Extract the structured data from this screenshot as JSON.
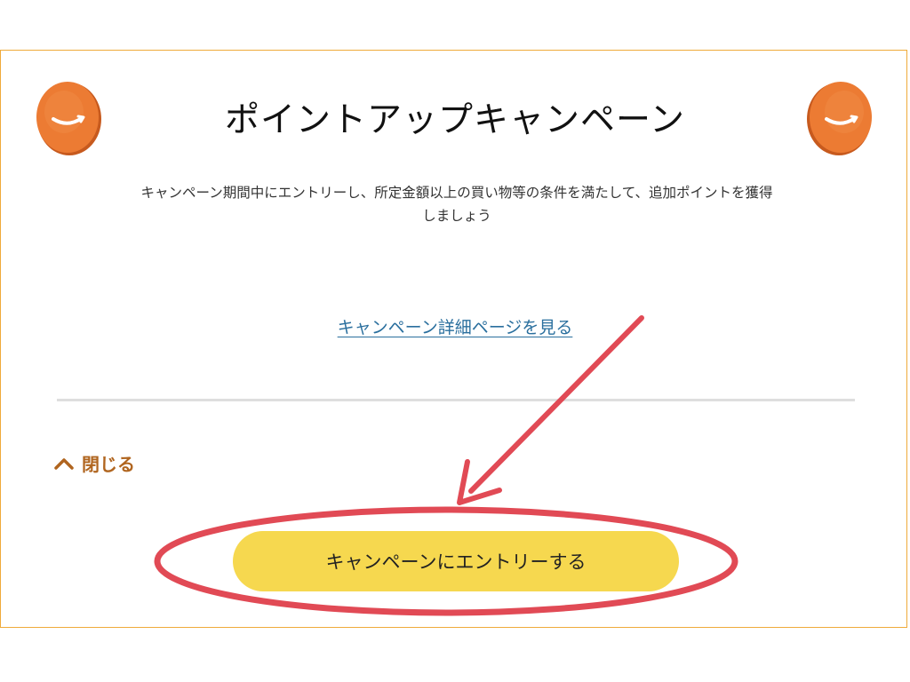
{
  "campaign": {
    "title": "ポイントアップキャンペーン",
    "description": "キャンペーン期間中にエントリーし、所定金額以上の買い物等の条件を満たして、追加ポイントを獲得しましょう",
    "detail_link": "キャンペーン詳細ページを見る",
    "close_label": "閉じる",
    "entry_button": "キャンペーンにエントリーする"
  },
  "icons": {
    "coin": "amazon-coin-icon",
    "chevron": "chevron-up-icon"
  },
  "colors": {
    "panel_border": "#efaa3a",
    "coin": "#e8732c",
    "link": "#2a6f9e",
    "close_label": "#b0651f",
    "entry_button": "#f6d84f",
    "annotation": "#e14a55"
  }
}
